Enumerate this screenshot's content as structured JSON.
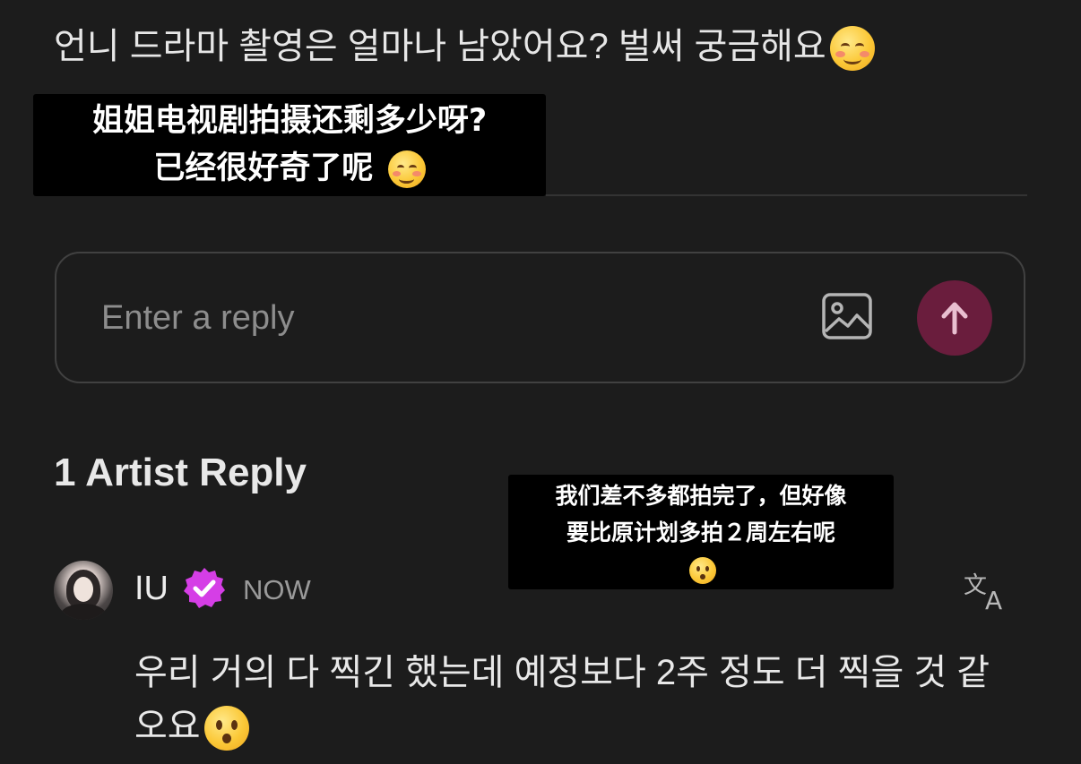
{
  "post": {
    "text_ko": "언니 드라마 촬영은 얼마나 남았어요? 벌써 궁금해요",
    "emoji": "smiling-face-emoji"
  },
  "caption_top": {
    "line1": "姐姐电视剧拍摄还剩多少呀?",
    "line2": "已经很好奇了呢",
    "emoji": "smiling-face-emoji"
  },
  "reply_input": {
    "placeholder": "Enter a reply",
    "image_icon": "image-icon",
    "send_icon": "arrow-up-icon",
    "send_color": "#6a1d3d"
  },
  "artist_reply": {
    "heading": "1 Artist Reply",
    "author": "IU",
    "badge_icon": "verified-badge-icon",
    "badge_color": "#d53ee6",
    "timestamp": "NOW",
    "translate_icon": "translate-icon",
    "text_line1": "우리 거의 다 찍긴 했는데 예정보다 2주 정도 더 찍을 것 같",
    "text_line2": "오요",
    "emoji": "hushed-face-emoji"
  },
  "caption_mid": {
    "line1": "我们差不多都拍完了，但好像",
    "line2": "要比原计划多拍２周左右呢",
    "emoji": "hushed-face-emoji"
  }
}
